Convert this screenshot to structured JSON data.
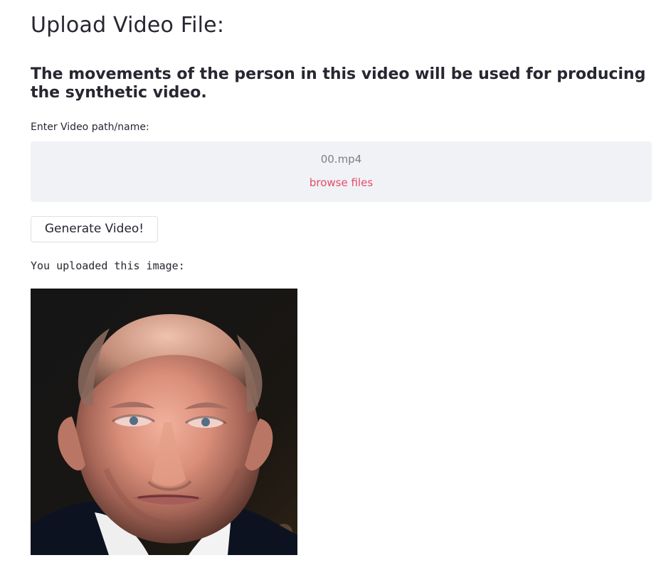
{
  "page": {
    "title": "Upload Video File:",
    "subheading": "The movements of the person in this video will be used for producing the synthetic video.",
    "field_label": "Enter Video path/name:"
  },
  "uploader": {
    "file_name": "00.mp4",
    "browse_label": "browse files"
  },
  "actions": {
    "generate_label": "Generate Video!"
  },
  "output": {
    "message": "You uploaded this image:"
  },
  "colors": {
    "text": "#262730",
    "dropzone_bg": "#f0f2f6",
    "muted_text": "#7d7f88",
    "link": "#e44c68",
    "button_border": "#dedfe3",
    "image_background": "#17130f"
  }
}
